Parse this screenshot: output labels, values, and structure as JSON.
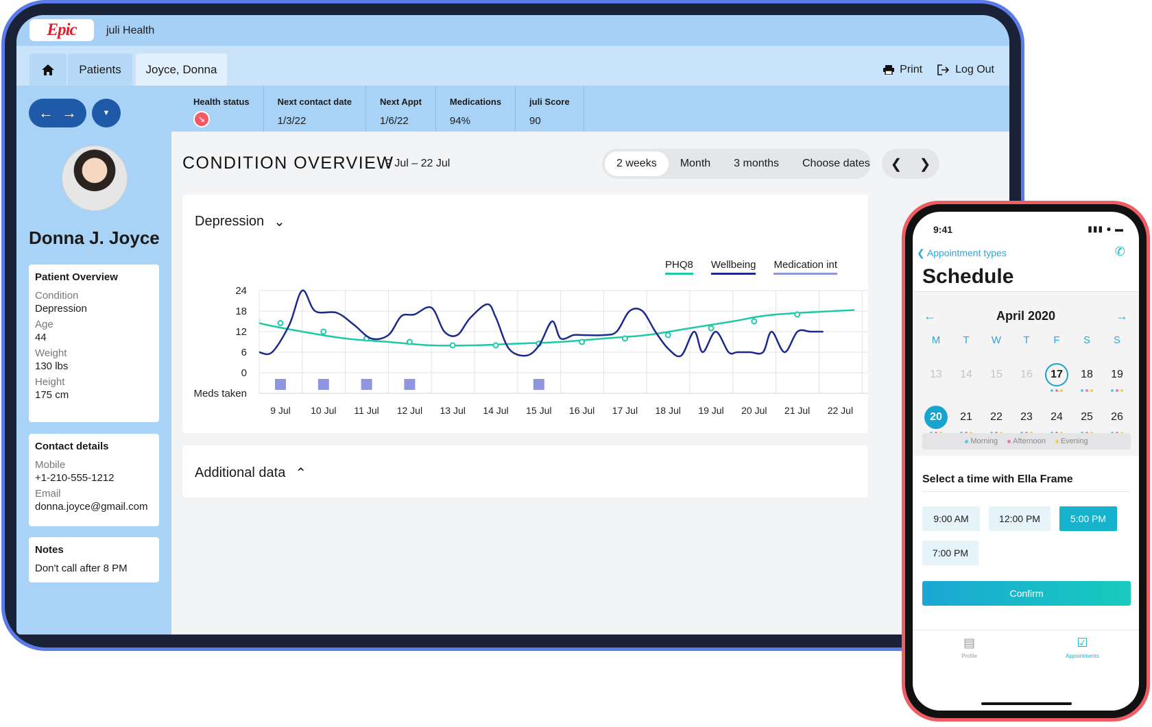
{
  "app": {
    "logo": "Epic",
    "org": "juli Health"
  },
  "tabs": {
    "home_icon": "home-icon",
    "patients": "Patients",
    "active": "Joyce, Donna"
  },
  "actions": {
    "print": "Print",
    "logout": "Log Out"
  },
  "stats": [
    {
      "label": "Health status",
      "value": "",
      "icon": "trend-down-icon"
    },
    {
      "label": "Next contact date",
      "value": "1/3/22"
    },
    {
      "label": "Next Appt",
      "value": "1/6/22"
    },
    {
      "label": "Medications",
      "value": "94%"
    },
    {
      "label": "juli Score",
      "value": "90"
    }
  ],
  "patient": {
    "name": "Donna J. Joyce",
    "overview_title": "Patient Overview",
    "condition_label": "Condition",
    "condition": "Depression",
    "age_label": "Age",
    "age": "44",
    "weight_label": "Weight",
    "weight": "130 lbs",
    "height_label": "Height",
    "height": "175 cm",
    "contact_title": "Contact details",
    "mobile_label": "Mobile",
    "mobile": "+1-210-555-1212",
    "email_label": "Email",
    "email": "donna.joyce@gmail.com",
    "notes_title": "Notes",
    "notes": "Don't call after 8 PM"
  },
  "main": {
    "title": "CONDITION OVERVIEW",
    "range": "9 Jul – 22 Jul",
    "segments": [
      "2 weeks",
      "Month",
      "3 months",
      "Choose dates"
    ],
    "selected_segment": "2 weeks",
    "chart_title": "Depression",
    "additional": "Additional data"
  },
  "chart_data": {
    "type": "line",
    "categories": [
      "9 Jul",
      "10 Jul",
      "11 Jul",
      "12 Jul",
      "13 Jul",
      "14 Jul",
      "15 Jul",
      "16  Jul",
      "17 Jul",
      "18 Jul",
      "19 Jul",
      "20 Jul",
      "21 Jul",
      "22 Jul"
    ],
    "y_ticks": [
      24,
      18,
      12,
      6,
      0
    ],
    "ylim": [
      0,
      24
    ],
    "meds_label": "Meds taken",
    "meds_taken_days": [
      "9 Jul",
      "10 Jul",
      "11 Jul",
      "12 Jul",
      "15 Jul"
    ],
    "legend": [
      "PHQ8",
      "Wellbeing",
      "Medication int"
    ],
    "colors": {
      "phq8": "#1dc8a8",
      "wellbeing": "#1b2a8a",
      "medication": "#8f95e0"
    },
    "series": [
      {
        "name": "PHQ8",
        "x": [
          9,
          10,
          11,
          12,
          13,
          14,
          15,
          16,
          17,
          18,
          19,
          20,
          21
        ],
        "values": [
          14.5,
          12,
          10,
          9,
          8,
          8,
          8.5,
          9,
          10,
          11,
          13,
          15,
          17
        ]
      },
      {
        "name": "Wellbeing",
        "x": [
          9,
          9.3,
          9.7,
          10,
          10.3,
          10.8,
          11.2,
          11.6,
          12,
          12.3,
          12.6,
          13,
          13.3,
          13.6,
          13.9,
          14.3,
          14.5,
          14.8,
          15.2,
          15.5,
          15.8,
          16,
          16.3,
          16.5,
          17,
          17.3,
          17.6,
          17.9,
          18.2,
          18.5,
          18.8,
          19.1,
          19.3,
          19.6,
          19.9,
          20.1,
          20.4,
          20.7,
          20.9,
          21.2,
          21.5,
          21.8,
          22.1
        ],
        "values": [
          6,
          6,
          14,
          24,
          18,
          17.5,
          14,
          10,
          11,
          16.5,
          17,
          19,
          12,
          11,
          16,
          20,
          16,
          7,
          5,
          8,
          15,
          10,
          11,
          11,
          11,
          12,
          18,
          18,
          12,
          7,
          5,
          12,
          6,
          12,
          6,
          6,
          6,
          6,
          12,
          6,
          12,
          12,
          12
        ]
      }
    ]
  },
  "phone": {
    "time": "9:41",
    "back": "Appointment types",
    "title": "Schedule",
    "month": "April 2020",
    "dow": [
      "M",
      "T",
      "W",
      "T",
      "F",
      "S",
      "S"
    ],
    "week1": [
      "13",
      "14",
      "15",
      "16",
      "17",
      "18",
      "19"
    ],
    "week2": [
      "20",
      "21",
      "22",
      "23",
      "24",
      "25",
      "26"
    ],
    "legend": [
      "Morning",
      "Afternoon",
      "Evening"
    ],
    "subtitle": "Select a time with Ella Frame",
    "slots": [
      "9:00 AM",
      "12:00 PM",
      "5:00 PM",
      "7:00 PM"
    ],
    "selected_slot": "5:00 PM",
    "confirm": "Confirm",
    "tab_profile": "Profile",
    "tab_appointments": "Appointments"
  }
}
